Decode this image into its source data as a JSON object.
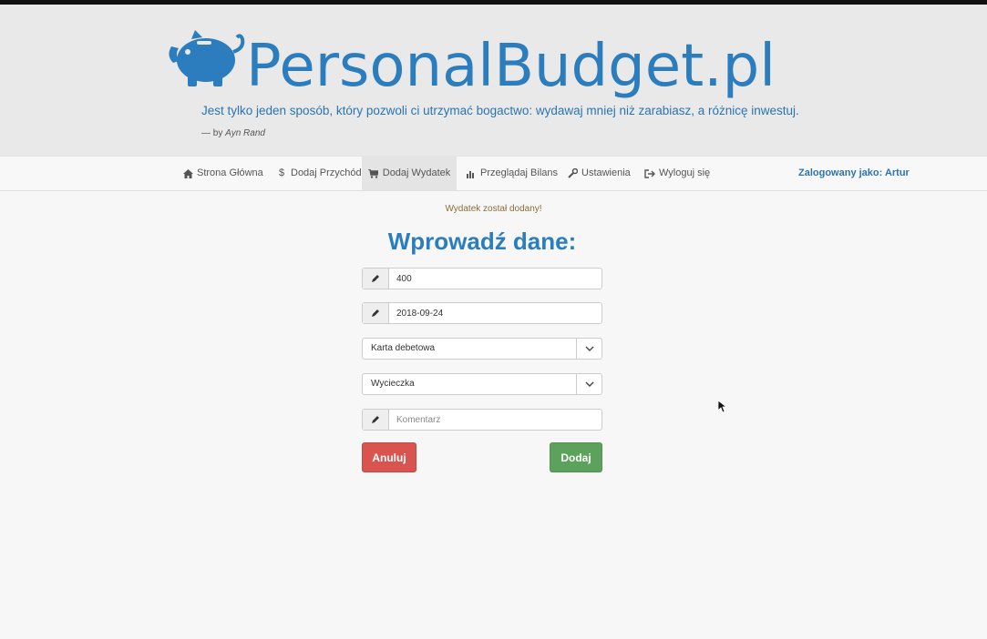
{
  "header": {
    "brand": "PersonalBudget.pl",
    "quote": "Jest tylko jeden sposób, który pozwoli ci utrzymać bogactwo: wydawaj mniej niż zarabiasz, a różnicę inwestuj.",
    "author_prefix": "— by",
    "author_name": "Ayn Rand"
  },
  "nav": {
    "items": [
      {
        "label": "Strona Główna",
        "icon": "home-icon"
      },
      {
        "label": "Dodaj Przychód",
        "icon": "dollar-icon"
      },
      {
        "label": "Dodaj Wydatek",
        "icon": "cart-icon",
        "active": true
      },
      {
        "label": "Przeglądaj Bilans",
        "icon": "bar-chart-icon"
      },
      {
        "label": "Ustawienia",
        "icon": "wrench-icon"
      },
      {
        "label": "Wyloguj się",
        "icon": "logout-icon"
      }
    ],
    "logged_in": "Zalogowany jako: Artur"
  },
  "main": {
    "alert": "Wydatek został dodany!",
    "title": "Wprowadź dane:",
    "amount_value": "400",
    "date_value": "2018-09-24",
    "payment_method": "Karta debetowa",
    "category": "Wycieczka",
    "comment_placeholder": "Komentarz",
    "cancel_label": "Anuluj",
    "add_label": "Dodaj"
  },
  "colors": {
    "brand": "#2b7dbd",
    "cancel": "#d9534f",
    "add": "#5ca25c",
    "alert_text": "#8a6d3b"
  }
}
